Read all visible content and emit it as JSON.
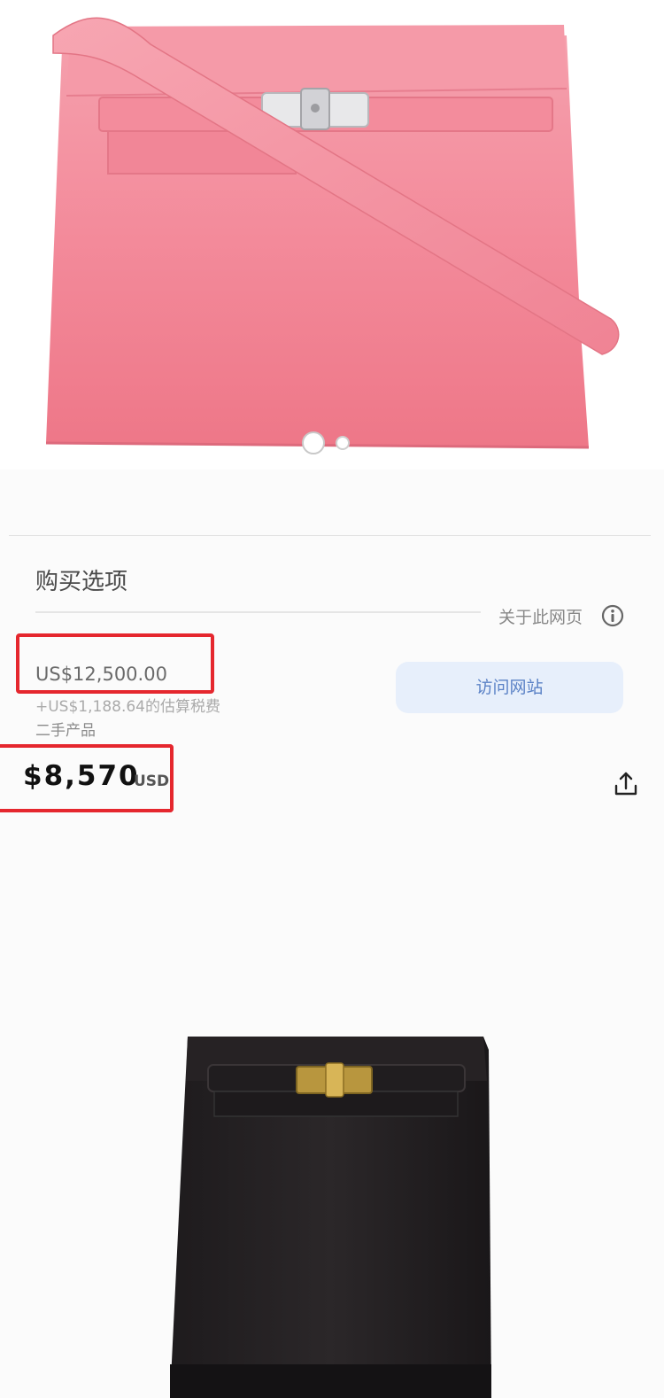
{
  "hero": {
    "image": "pink-kelly-bag",
    "color": "#f28a9b",
    "dots": {
      "count": 2,
      "active_index": 0
    }
  },
  "purchase": {
    "section_title": "购买选项",
    "about_page": "关于此网页",
    "listing_price": "US$12,500.00",
    "tax_note": "+US$1,188.64的估算税费",
    "condition": "二手产品",
    "visit_button": "访问网站"
  },
  "resale": {
    "price": "$8,570",
    "currency": "USD"
  },
  "colors": {
    "highlight": "#e5272e",
    "button_bg": "#e7effb",
    "button_text": "#5b82c6"
  },
  "icons": {
    "info": "info-icon",
    "share": "share-icon"
  },
  "second_product": {
    "image": "black-kelly-ado-bag"
  }
}
